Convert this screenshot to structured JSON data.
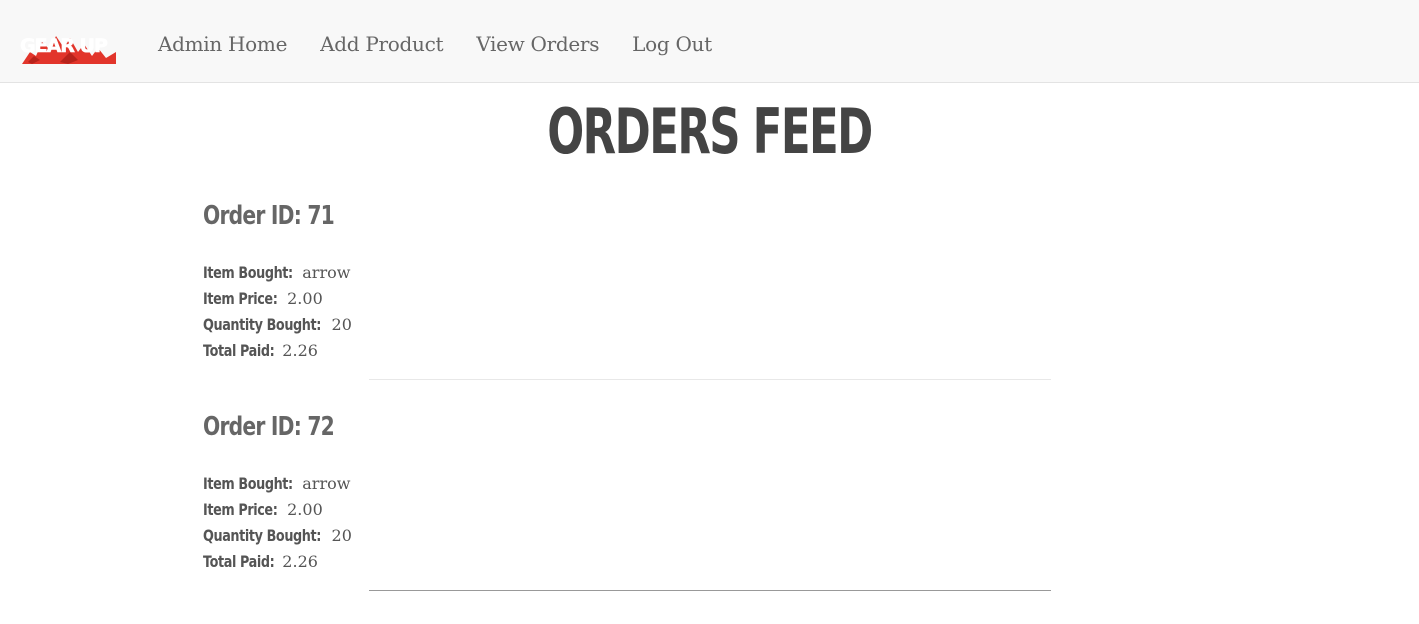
{
  "nav": {
    "logo_text": "GEAR UP",
    "links": [
      "Admin Home",
      "Add Product",
      "View Orders",
      "Log Out"
    ]
  },
  "page": {
    "title": "ORDERS FEED"
  },
  "labels": {
    "item_bought": "Item Bought:",
    "item_price": "Item Price:",
    "quantity_bought": "Quantity Bought:",
    "total_paid": "Total Paid:"
  },
  "orders": [
    {
      "heading": "Order ID: 71",
      "item_bought": "arrow",
      "item_price": "2.00",
      "quantity_bought": "20",
      "total_paid": "2.26"
    },
    {
      "heading": "Order ID: 72",
      "item_bought": "arrow",
      "item_price": "2.00",
      "quantity_bought": "20",
      "total_paid": "2.26"
    }
  ],
  "colors": {
    "navbar_bg": "#f8f8f8",
    "logo_red": "#e2352b",
    "text_dark": "#444444",
    "text_muted": "#666666"
  }
}
